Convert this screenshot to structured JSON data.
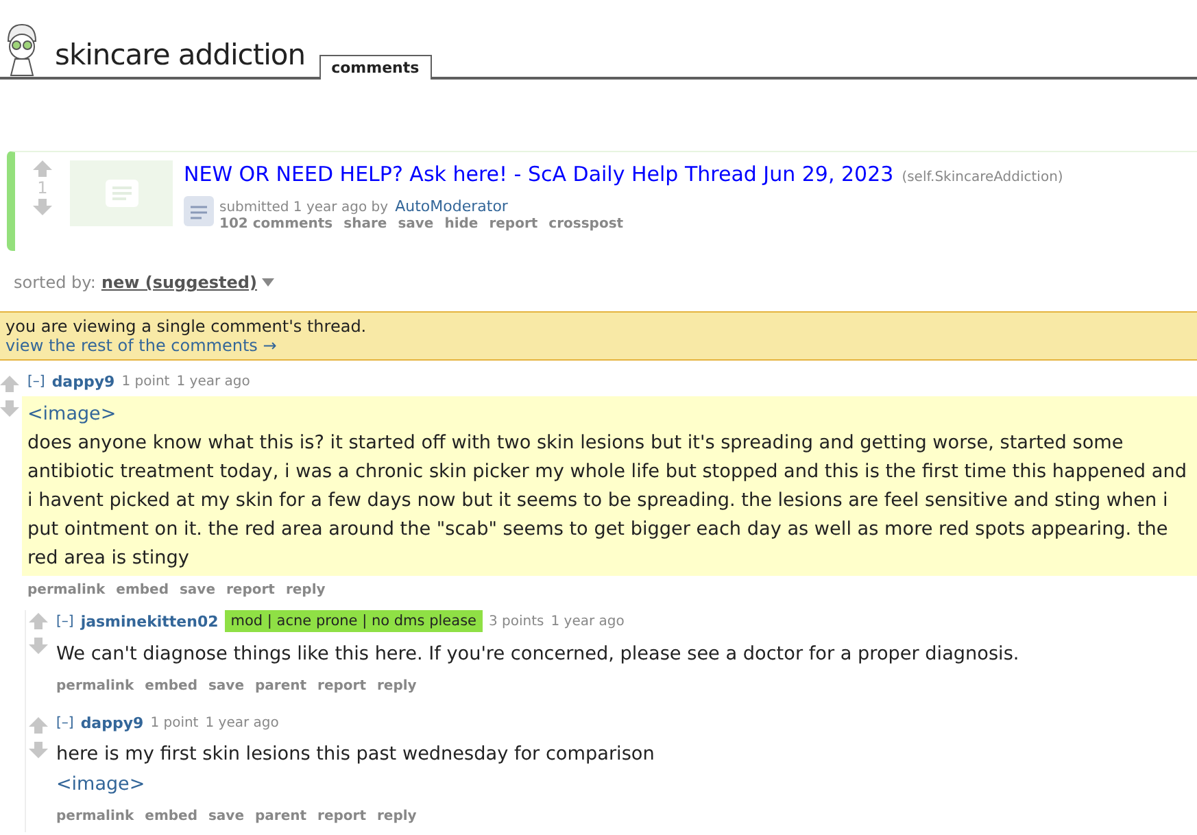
{
  "header": {
    "title": "skincare addiction",
    "tabs": [
      {
        "label": "comments",
        "selected": true
      }
    ]
  },
  "post": {
    "score": "1",
    "title": "NEW OR NEED HELP? Ask here! - ScA Daily Help Thread Jun 29, 2023",
    "domain": "(self.SkincareAddiction)",
    "submitted": "submitted 1 year ago by",
    "author": "AutoModerator",
    "actions": [
      "102 comments",
      "share",
      "save",
      "hide",
      "report",
      "crosspost"
    ]
  },
  "sort": {
    "label": "sorted by:",
    "value": "new (suggested)"
  },
  "notice": {
    "text": "you are viewing a single comment's thread.",
    "link": "view the rest of the comments →"
  },
  "comments": [
    {
      "toggle": "[–]",
      "author": "dappy9",
      "score": "1 point",
      "age": "1 year ago",
      "highlighted": true,
      "body": [
        {
          "kind": "link",
          "text": "<image>"
        },
        {
          "kind": "text",
          "text": "does anyone know what this is? it started off with two skin lesions but it's spreading and getting worse, started some antibiotic treatment today, i was a chronic skin picker my whole life but stopped and this is the first time this happened and i havent picked at my skin for a few days now but it seems to be spreading. the lesions are feel sensitive and sting when i put ointment on it. the red area around the \"scab\" seems to get bigger each day as well as more red spots appearing. the red area is stingy"
        }
      ],
      "actions": [
        "permalink",
        "embed",
        "save",
        "report",
        "reply"
      ],
      "children": [
        {
          "toggle": "[–]",
          "author": "jasminekitten02",
          "flair": "mod | acne prone | no dms please",
          "score": "3 points",
          "age": "1 year ago",
          "highlighted": false,
          "body": [
            {
              "kind": "text",
              "text": "We can't diagnose things like this here. If you're concerned, please see a doctor for a proper diagnosis."
            }
          ],
          "actions": [
            "permalink",
            "embed",
            "save",
            "parent",
            "report",
            "reply"
          ]
        },
        {
          "toggle": "[–]",
          "author": "dappy9",
          "score": "1 point",
          "age": "1 year ago",
          "highlighted": false,
          "body": [
            {
              "kind": "text",
              "text": "here is my first skin lesions this past wednesday for comparison"
            },
            {
              "kind": "link",
              "text": "<image>"
            }
          ],
          "actions": [
            "permalink",
            "embed",
            "save",
            "parent",
            "report",
            "reply"
          ]
        }
      ]
    }
  ]
}
